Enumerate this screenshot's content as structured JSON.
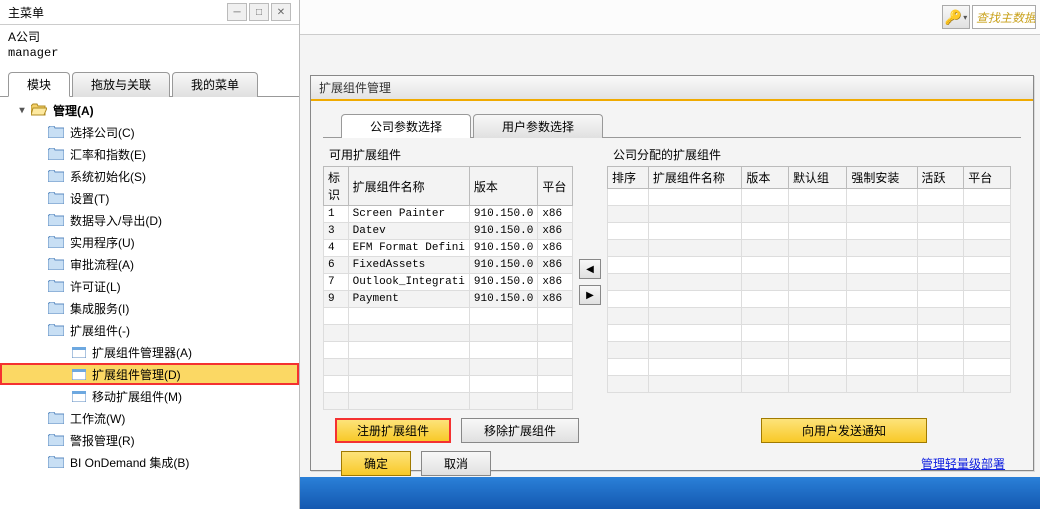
{
  "left": {
    "title": "主菜单",
    "company": "A公司",
    "user": "manager",
    "tabs": [
      "模块",
      "拖放与关联",
      "我的菜单"
    ],
    "root": "管理(A)",
    "items": [
      "选择公司(C)",
      "汇率和指数(E)",
      "系统初始化(S)",
      "设置(T)",
      "数据导入/导出(D)",
      "实用程序(U)",
      "审批流程(A)",
      "许可证(L)",
      "集成服务(I)",
      "扩展组件(-)"
    ],
    "subitems": [
      "扩展组件管理器(A)",
      "扩展组件管理(D)",
      "移动扩展组件(M)"
    ],
    "rest": [
      "工作流(W)",
      "警报管理(R)",
      "BI OnDemand 集成(B)"
    ]
  },
  "right": {
    "search_placeholder": "查找主数据和",
    "window_title": "扩展组件管理",
    "tabs": [
      "公司参数选择",
      "用户参数选择"
    ],
    "left_section_title": "可用扩展组件",
    "left_cols": [
      "标识",
      "扩展组件名称",
      "版本",
      "平台"
    ],
    "rows": [
      {
        "id": "1",
        "name": "Screen Painter",
        "ver": "910.150.0",
        "plat": "x86"
      },
      {
        "id": "3",
        "name": "Datev",
        "ver": "910.150.0",
        "plat": "x86"
      },
      {
        "id": "4",
        "name": "EFM Format Defini",
        "ver": "910.150.0",
        "plat": "x86"
      },
      {
        "id": "6",
        "name": "FixedAssets",
        "ver": "910.150.0",
        "plat": "x86"
      },
      {
        "id": "7",
        "name": "Outlook_Integrati",
        "ver": "910.150.0",
        "plat": "x86"
      },
      {
        "id": "9",
        "name": "Payment",
        "ver": "910.150.0",
        "plat": "x86"
      }
    ],
    "right_section_title": "公司分配的扩展组件",
    "right_cols": [
      "排序",
      "扩展组件名称",
      "版本",
      "默认组",
      "强制安装",
      "活跃",
      "平台"
    ],
    "btn_register": "注册扩展组件",
    "btn_remove": "移除扩展组件",
    "btn_notify": "向用户发送通知",
    "btn_ok": "确定",
    "btn_cancel": "取消",
    "link": "管理轻量级部署"
  }
}
